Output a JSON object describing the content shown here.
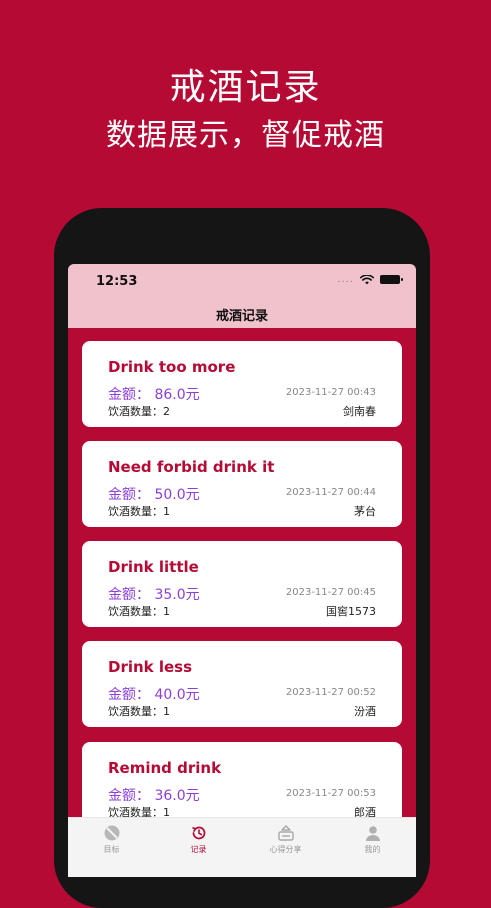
{
  "promo": {
    "title": "戒酒记录",
    "subtitle": "数据展示，督促戒酒"
  },
  "status_bar": {
    "time": "12:53",
    "signal": "....",
    "wifi_icon": "wifi-icon",
    "battery_icon": "battery-icon"
  },
  "nav": {
    "title": "戒酒记录"
  },
  "records": [
    {
      "title": "Drink too more",
      "amount": "金额：  86.0元",
      "date": "2023-11-27 00:43",
      "count": "饮酒数量：2",
      "brand": "剑南春"
    },
    {
      "title": "Need forbid drink it",
      "amount": "金额：  50.0元",
      "date": "2023-11-27 00:44",
      "count": "饮酒数量：1",
      "brand": "茅台"
    },
    {
      "title": "Drink little",
      "amount": "金额：  35.0元",
      "date": "2023-11-27 00:45",
      "count": "饮酒数量：1",
      "brand": "国窖1573"
    },
    {
      "title": "Drink less",
      "amount": "金额：  40.0元",
      "date": "2023-11-27 00:52",
      "count": "饮酒数量：1",
      "brand": "汾酒"
    },
    {
      "title": "Remind drink",
      "amount": "金额：  36.0元",
      "date": "2023-11-27 00:53",
      "count": "饮酒数量：1",
      "brand": "郎酒"
    }
  ],
  "tabs": [
    {
      "label": "目标",
      "icon": "target-icon",
      "active": false
    },
    {
      "label": "记录",
      "icon": "history-icon",
      "active": true
    },
    {
      "label": "心得分享",
      "icon": "share-icon",
      "active": false
    },
    {
      "label": "我的",
      "icon": "profile-icon",
      "active": false
    }
  ],
  "colors": {
    "background": "#b40a34",
    "header": "#f0c2cb",
    "accent": "#b40a34",
    "amount": "#8c3fd8"
  }
}
